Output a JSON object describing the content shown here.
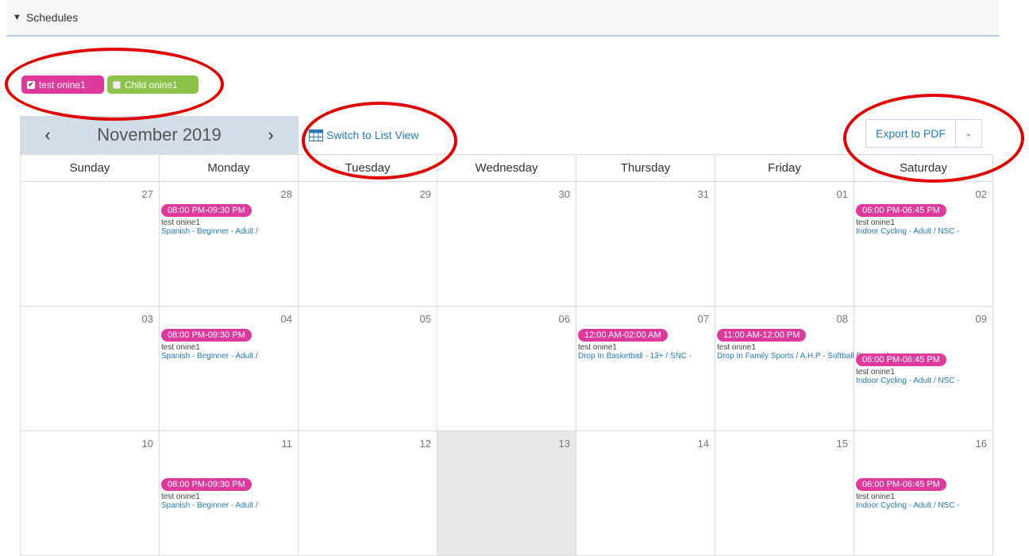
{
  "header": {
    "title": "Schedules"
  },
  "filters": [
    {
      "label": "test onine1",
      "checked": true,
      "color": "#e0399e"
    },
    {
      "label": "Child onine1",
      "checked": false,
      "color": "#8dc34a"
    }
  ],
  "toolbar": {
    "prev": "‹",
    "next": "›",
    "month_title": "November 2019",
    "switch_view": "Switch to List View",
    "export": "Export to PDF"
  },
  "weekdays": [
    "Sunday",
    "Monday",
    "Tuesday",
    "Wednesday",
    "Thursday",
    "Friday",
    "Saturday"
  ],
  "weeks": [
    {
      "days": [
        {
          "num": "27",
          "events": []
        },
        {
          "num": "28",
          "events": [
            {
              "time": "08:00 PM-09:30 PM",
              "user": "test onine1",
              "title": "Spanish - Beginner - Adult /"
            }
          ]
        },
        {
          "num": "29",
          "events": []
        },
        {
          "num": "30",
          "events": []
        },
        {
          "num": "31",
          "events": []
        },
        {
          "num": "01",
          "events": []
        },
        {
          "num": "02",
          "events": [
            {
              "time": "06:00 PM-06:45 PM",
              "user": "test onine1",
              "title": "Indoor Cycling - Adult / NSC -"
            }
          ]
        }
      ]
    },
    {
      "days": [
        {
          "num": "03",
          "events": []
        },
        {
          "num": "04",
          "events": [
            {
              "time": "08:00 PM-09:30 PM",
              "user": "test onine1",
              "title": "Spanish - Beginner - Adult /"
            }
          ]
        },
        {
          "num": "05",
          "events": []
        },
        {
          "num": "06",
          "events": []
        },
        {
          "num": "07",
          "events": [
            {
              "time": "12:00 AM-02:00 AM",
              "user": "test onine1",
              "title": "Drop In Basketball - 13+ / SNC -"
            }
          ]
        },
        {
          "num": "08",
          "events": [
            {
              "time": "11:00 AM-12:00 PM",
              "user": "test onine1",
              "title": "Drop In Family Sports / A.H.P - Softball Diamond"
            }
          ]
        },
        {
          "num": "09",
          "events": [
            {
              "time": "06:00 PM-06:45 PM",
              "user": "test onine1",
              "title": "Indoor Cycling - Adult / NSC -"
            }
          ]
        }
      ]
    },
    {
      "days": [
        {
          "num": "10",
          "events": []
        },
        {
          "num": "11",
          "events": [
            {
              "time": "08:00 PM-09:30 PM",
              "user": "test onine1",
              "title": "Spanish - Beginner - Adult /"
            }
          ]
        },
        {
          "num": "12",
          "events": []
        },
        {
          "num": "13",
          "events": [],
          "today": true
        },
        {
          "num": "14",
          "events": []
        },
        {
          "num": "15",
          "events": []
        },
        {
          "num": "16",
          "events": [
            {
              "time": "06:00 PM-06:45 PM",
              "user": "test onine1",
              "title": "Indoor Cycling - Adult / NSC -"
            }
          ]
        }
      ]
    }
  ]
}
